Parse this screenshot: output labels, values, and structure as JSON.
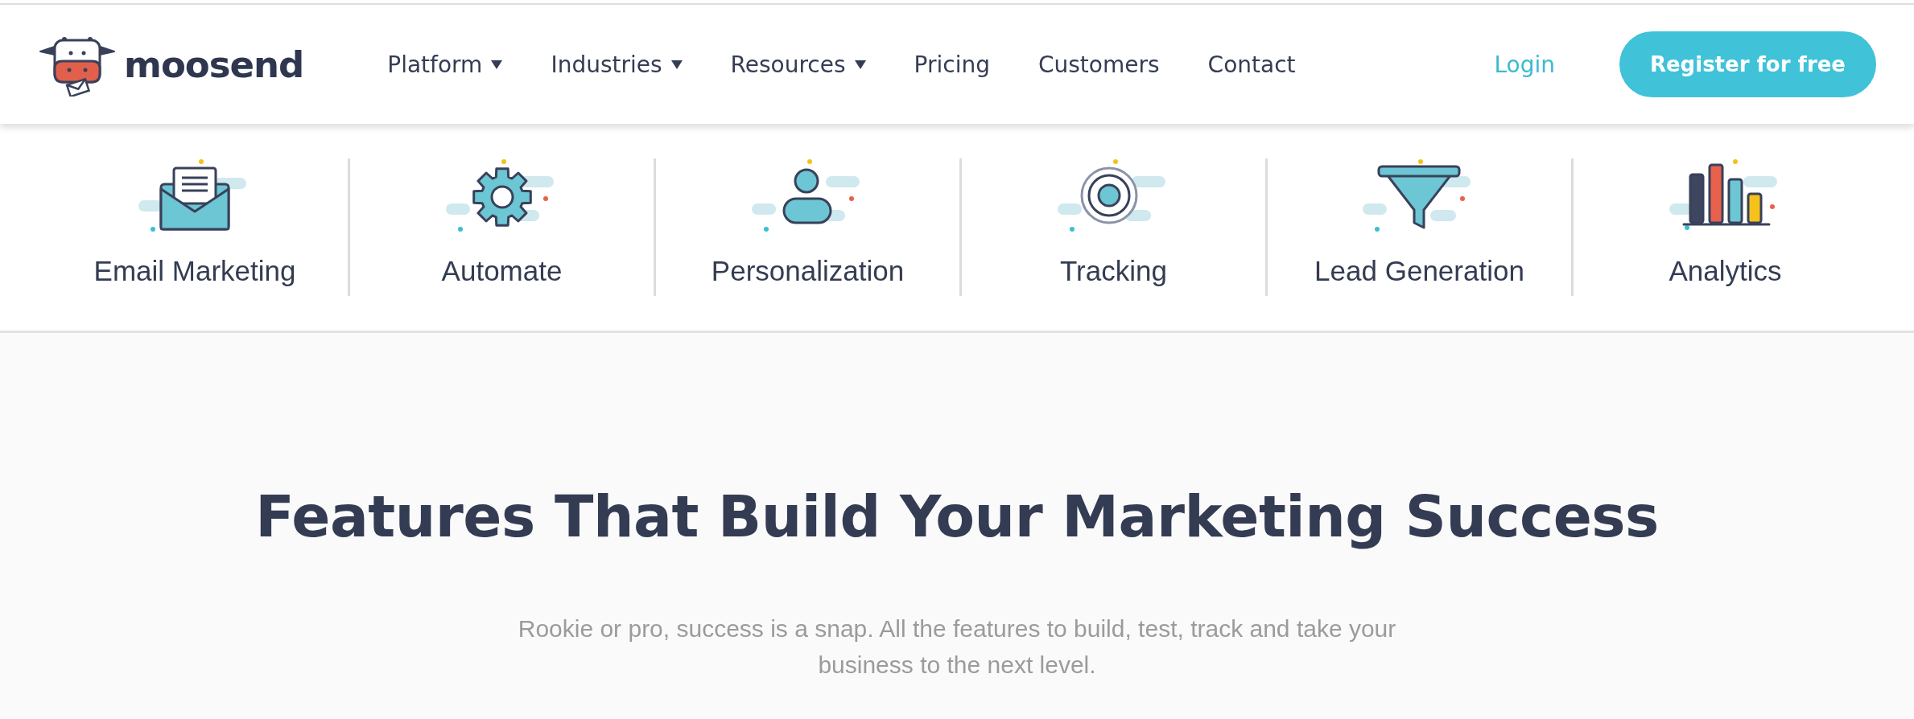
{
  "header": {
    "logo": {
      "text": "moosend"
    },
    "nav": [
      {
        "label": "Platform",
        "dropdown": true
      },
      {
        "label": "Industries",
        "dropdown": true
      },
      {
        "label": "Resources",
        "dropdown": true
      },
      {
        "label": "Pricing",
        "dropdown": false
      },
      {
        "label": "Customers",
        "dropdown": false
      },
      {
        "label": "Contact",
        "dropdown": false
      }
    ],
    "login": "Login",
    "register_button": "Register for free"
  },
  "features": [
    {
      "label": "Email Marketing"
    },
    {
      "label": "Automate"
    },
    {
      "label": "Personalization"
    },
    {
      "label": "Tracking"
    },
    {
      "label": "Lead Generation"
    },
    {
      "label": "Analytics"
    }
  ],
  "hero": {
    "title": "Features That Build Your Marketing Success",
    "subtitle": "Rookie or pro, success is a snap. All the features to build, test, track and take your business to the next level."
  }
}
